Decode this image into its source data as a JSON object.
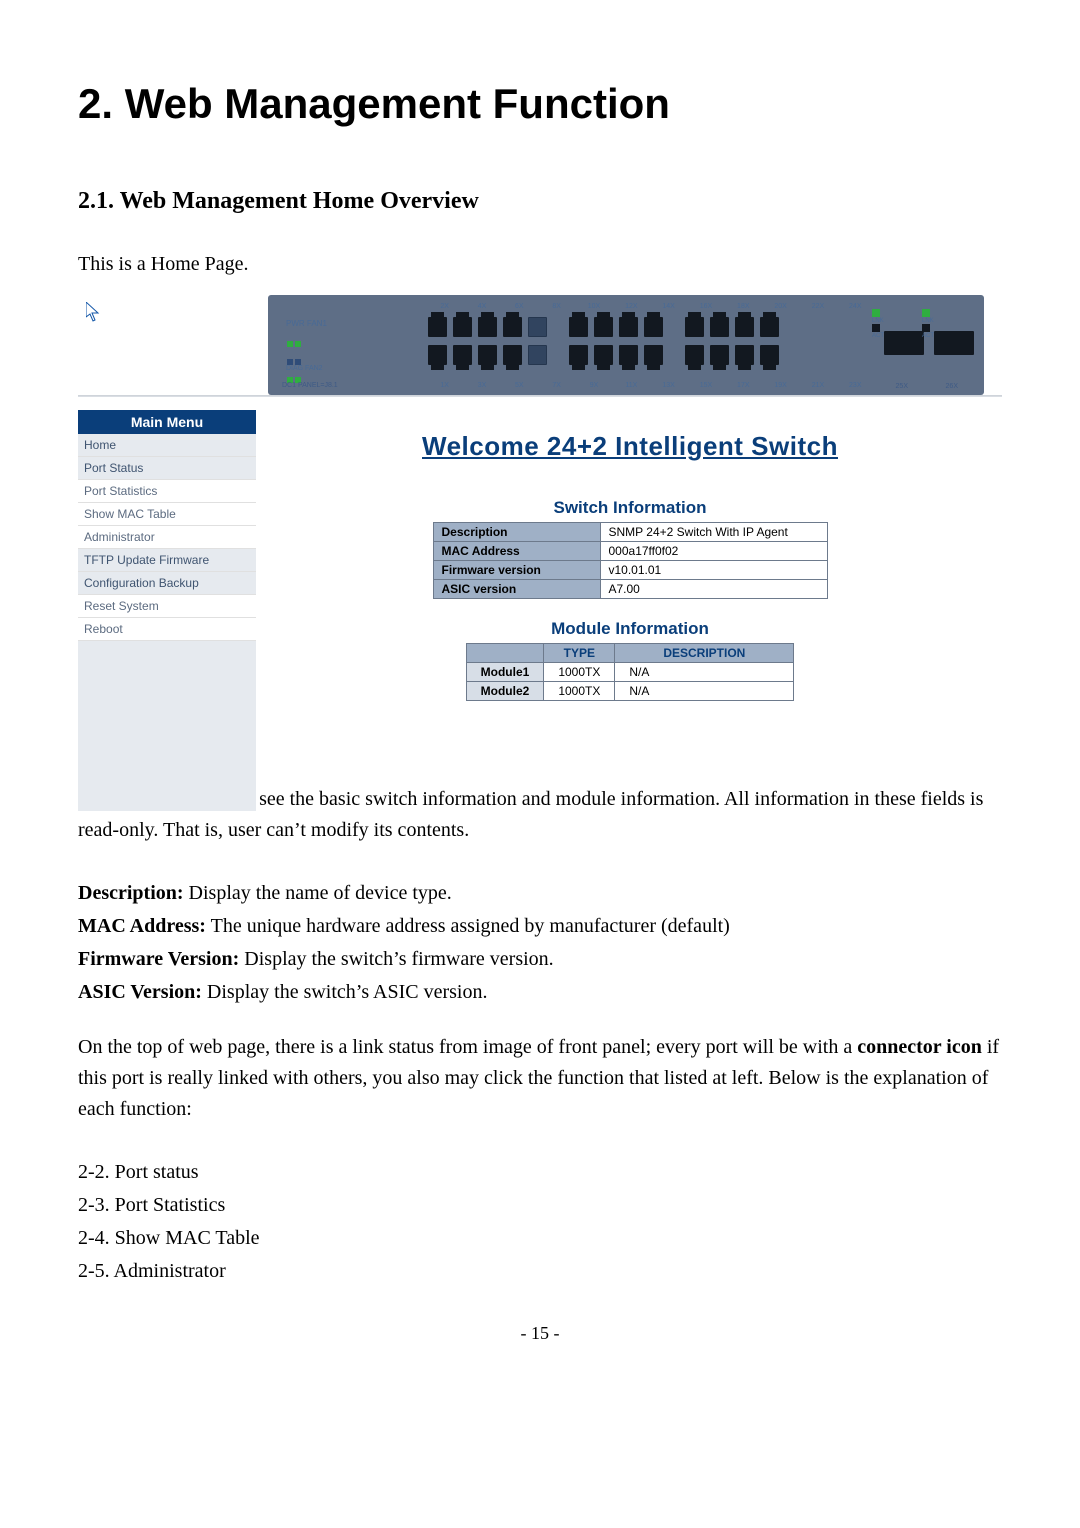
{
  "heading_chapter": "2. Web Management Function",
  "heading_section": "2.1. Web Management Home Overview",
  "intro_line": "This is a Home Page.",
  "panel": {
    "leds_label": "PWR FAN1",
    "label_dc1": "DIAG FAN2",
    "bottom_label": "DC1 PANEL=J8.1",
    "port_top_nums": [
      "2X",
      "4X",
      "6X",
      "8X",
      "10X",
      "12X",
      "14X",
      "16X",
      "18X",
      "20X",
      "22X",
      "24X"
    ],
    "port_bot_nums": [
      "1X",
      "3X",
      "5X",
      "7X",
      "9X",
      "11X",
      "13X",
      "15X",
      "17X",
      "19X",
      "21X",
      "23X"
    ],
    "mod_led_link": "LNK",
    "mod_led_act": "ACT",
    "mod_num_25": "25X",
    "mod_num_26": "26X"
  },
  "menu": {
    "header": "Main Menu",
    "items": [
      {
        "label": "Home",
        "sel": true
      },
      {
        "label": "Port Status",
        "sel": true
      },
      {
        "label": "Port Statistics",
        "sel": false
      },
      {
        "label": "Show MAC Table",
        "sel": false
      },
      {
        "label": "Administrator",
        "sel": false
      },
      {
        "label": "TFTP Update Firmware",
        "sel": true
      },
      {
        "label": "Configuration Backup",
        "sel": true
      },
      {
        "label": "Reset System",
        "sel": false
      },
      {
        "label": "Reboot",
        "sel": false
      }
    ]
  },
  "content": {
    "welcome": "Welcome 24+2 Intelligent Switch",
    "switch_title": "Switch Information",
    "switch_rows": [
      {
        "k": "Description",
        "v": "SNMP 24+2 Switch With IP Agent"
      },
      {
        "k": "MAC Address",
        "v": "000a17ff0f02"
      },
      {
        "k": "Firmware version",
        "v": "v10.01.01"
      },
      {
        "k": "ASIC version",
        "v": "A7.00"
      }
    ],
    "module_title": "Module Information",
    "module_head": [
      "",
      "TYPE",
      "DESCRIPTION"
    ],
    "module_rows": [
      {
        "k": "Module1",
        "type": "1000TX",
        "desc": "N/A"
      },
      {
        "k": "Module2",
        "type": "1000TX",
        "desc": "N/A"
      }
    ]
  },
  "para1": "At this page, you may see the basic switch information and module information. All information in these fields is read-only. That is, user can’t modify its contents.",
  "desc_lines": [
    {
      "b": "Description:",
      "t": " Display the name of device type."
    },
    {
      "b": "MAC Address:",
      "t": " The unique hardware address assigned by manufacturer (default)"
    },
    {
      "b": "Firmware Version:",
      "t": " Display the switch’s firmware version."
    },
    {
      "b": "ASIC Version:",
      "t": " Display the switch’s ASIC version."
    }
  ],
  "para2a": "On the top of web page, there is a link status from image of front panel; every port will be with a ",
  "para2b": "connector icon",
  "para2c": " if this port is really linked with others, you also may click the function that listed at left. Below is the explanation of each function:",
  "list_items": [
    "2-2. Port status",
    "2-3. Port Statistics",
    "2-4. Show MAC Table",
    "2-5. Administrator"
  ],
  "page_number": "- 15 -"
}
